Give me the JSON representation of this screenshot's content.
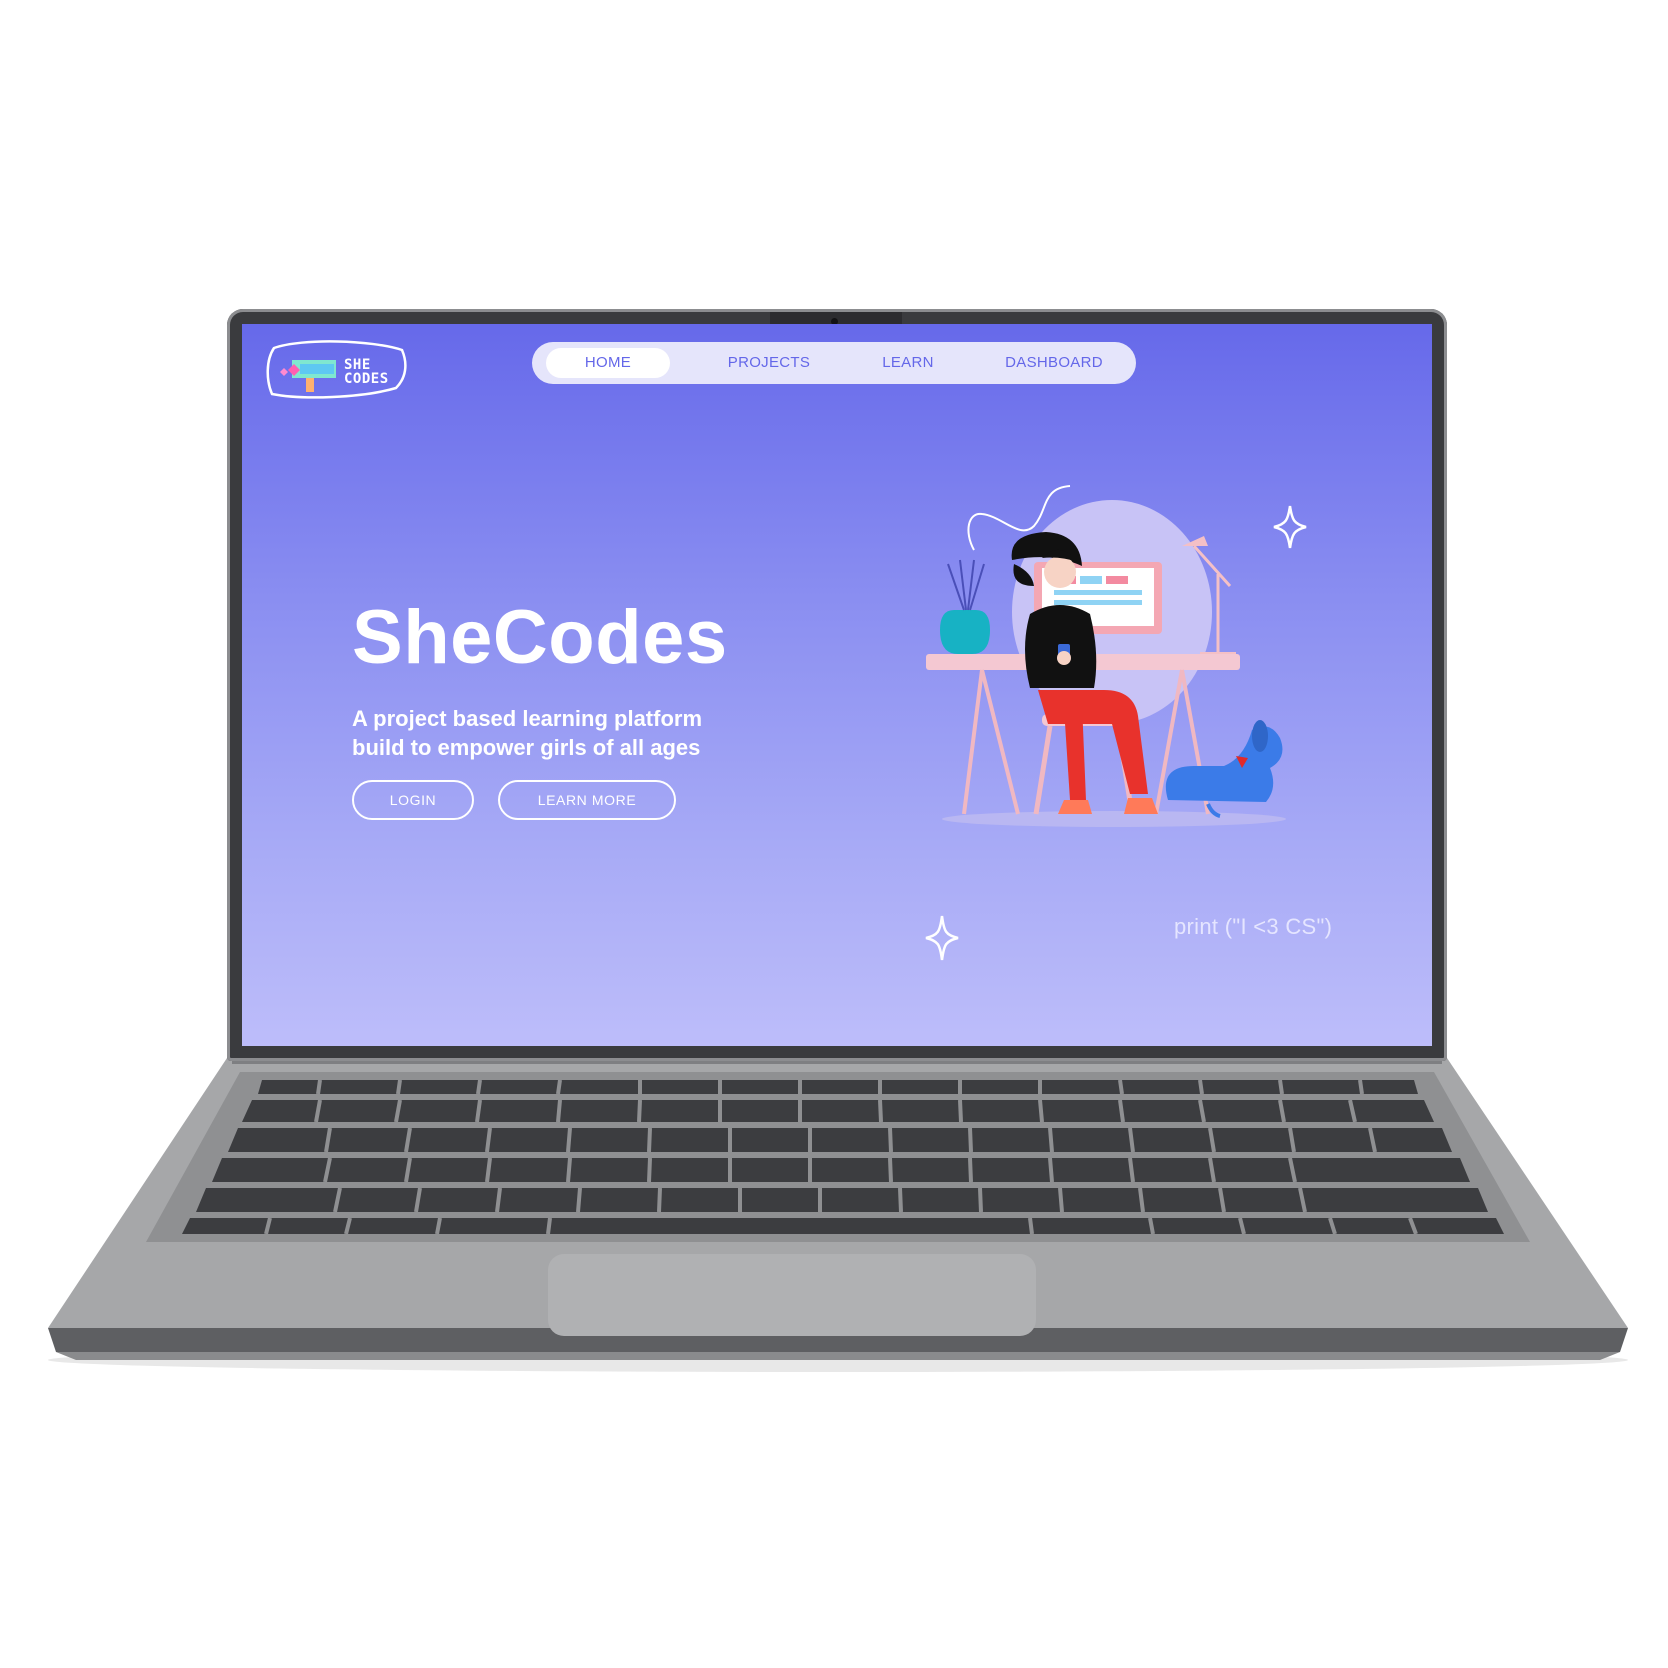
{
  "logo": {
    "line1": "SHE",
    "line2": "CODES"
  },
  "nav": {
    "items": [
      {
        "label": "HOME",
        "active": true
      },
      {
        "label": "PROJECTS",
        "active": false
      },
      {
        "label": "LEARN",
        "active": false
      },
      {
        "label": "DASHBOARD",
        "active": false
      }
    ]
  },
  "hero": {
    "title": "SheCodes",
    "subtitle_line1": "A project based learning platform",
    "subtitle_line2": "build to empower girls of all ages",
    "login_label": "LOGIN",
    "learn_more_label": "LEARN MORE"
  },
  "code_snippet": "print (\"I <3 CS\")",
  "icons": [
    "sparkle-icon",
    "squiggle-icon",
    "logo-icon",
    "plant-vase-icon",
    "lamp-icon",
    "dog-icon"
  ],
  "colors": {
    "accent": "#6467e9",
    "gradient_top": "#6669ea",
    "gradient_bottom": "#bdbdfa",
    "nav_bg": "#e5e5fb",
    "laptop_body": "#a5a6a8",
    "bezel": "#3a3b3e"
  }
}
